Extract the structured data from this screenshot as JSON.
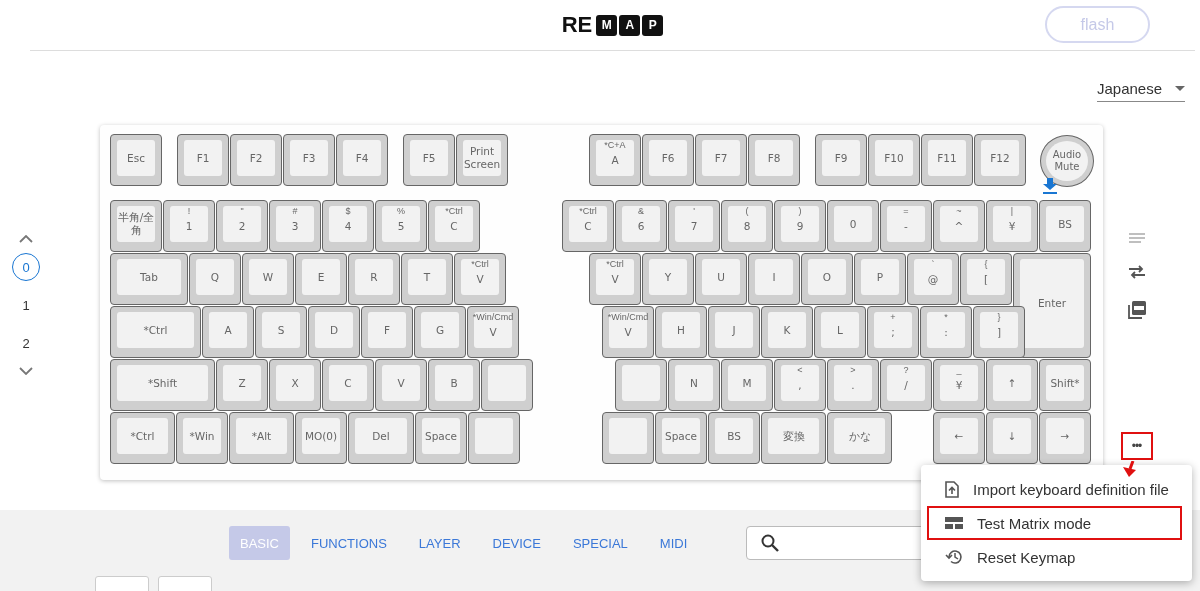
{
  "header": {
    "logo": [
      "RE",
      "M",
      "A",
      "P"
    ],
    "flash_button": {
      "label": "flash",
      "disabled": true
    }
  },
  "language_select": {
    "value": "Japanese"
  },
  "layers": [
    {
      "label": "0",
      "selected": true
    },
    {
      "label": "1",
      "selected": false
    },
    {
      "label": "2",
      "selected": false
    }
  ],
  "keyboard": {
    "left": [
      [
        {
          "kind": "square",
          "label": "Esc"
        },
        {
          "kind": "square",
          "label": "F1"
        },
        {
          "kind": "square",
          "label": "F2"
        },
        {
          "kind": "square",
          "label": "F3"
        },
        {
          "kind": "square",
          "label": "F4"
        },
        {
          "kind": "square",
          "label": "F5"
        },
        {
          "kind": "square",
          "label": "Print Screen"
        }
      ],
      [
        {
          "kind": "square",
          "label": "半角/全角"
        },
        {
          "kind": "square",
          "top": "!",
          "label": "1"
        },
        {
          "kind": "square",
          "top": "\"",
          "label": "2"
        },
        {
          "kind": "square",
          "top": "#",
          "label": "3"
        },
        {
          "kind": "square",
          "top": "$",
          "label": "4"
        },
        {
          "kind": "square",
          "top": "%",
          "label": "5"
        },
        {
          "kind": "square",
          "top": "*Ctrl",
          "label": "C"
        }
      ],
      [
        {
          "kind": "square",
          "label": "Tab"
        },
        {
          "kind": "square",
          "label": "Q"
        },
        {
          "kind": "square",
          "label": "W"
        },
        {
          "kind": "square",
          "label": "E"
        },
        {
          "kind": "square",
          "label": "R"
        },
        {
          "kind": "square",
          "label": "T"
        },
        {
          "kind": "square",
          "top": "*Ctrl",
          "label": "V"
        }
      ],
      [
        {
          "kind": "square",
          "label": "*Ctrl"
        },
        {
          "kind": "square",
          "label": "A"
        },
        {
          "kind": "square",
          "label": "S"
        },
        {
          "kind": "square",
          "label": "D"
        },
        {
          "kind": "square",
          "label": "F"
        },
        {
          "kind": "square",
          "label": "G"
        },
        {
          "kind": "square",
          "top": "*Win/Cmd",
          "label": "V"
        }
      ],
      [
        {
          "kind": "square",
          "label": "*Shift"
        },
        {
          "kind": "square",
          "label": "Z"
        },
        {
          "kind": "square",
          "label": "X"
        },
        {
          "kind": "square",
          "label": "C"
        },
        {
          "kind": "square",
          "label": "V"
        },
        {
          "kind": "square",
          "label": "B"
        },
        {
          "kind": "square"
        }
      ],
      [
        {
          "kind": "square",
          "label": "*Ctrl"
        },
        {
          "kind": "square",
          "label": "*Win"
        },
        {
          "kind": "square",
          "label": "*Alt"
        },
        {
          "kind": "square",
          "label": "MO(0)"
        },
        {
          "kind": "square",
          "label": "Del"
        },
        {
          "kind": "square",
          "label": "Space"
        },
        {
          "kind": "square"
        }
      ]
    ],
    "right": [
      [
        {
          "kind": "square",
          "top": "*C+A",
          "label": "A"
        },
        {
          "kind": "square",
          "label": "F6"
        },
        {
          "kind": "square",
          "label": "F7"
        },
        {
          "kind": "square",
          "label": "F8"
        },
        {
          "kind": "square",
          "label": "F9"
        },
        {
          "kind": "square",
          "label": "F10"
        },
        {
          "kind": "square",
          "label": "F11"
        },
        {
          "kind": "square",
          "label": "F12"
        },
        {
          "kind": "round",
          "label": "Audio Mute"
        }
      ],
      [
        {
          "kind": "square",
          "top": "*Ctrl",
          "label": "C"
        },
        {
          "kind": "square",
          "top": "&",
          "label": "6"
        },
        {
          "kind": "square",
          "top": "'",
          "label": "7"
        },
        {
          "kind": "square",
          "top": "(",
          "label": "8"
        },
        {
          "kind": "square",
          "top": ")",
          "label": "9"
        },
        {
          "kind": "square",
          "label": "0"
        },
        {
          "kind": "square",
          "top": "=",
          "label": "-"
        },
        {
          "kind": "square",
          "top": "~",
          "label": "^"
        },
        {
          "kind": "square",
          "top": "|",
          "label": "¥"
        },
        {
          "kind": "square",
          "label": "BS"
        }
      ],
      [
        {
          "kind": "square",
          "top": "*Ctrl",
          "label": "V"
        },
        {
          "kind": "square",
          "label": "Y"
        },
        {
          "kind": "square",
          "label": "U"
        },
        {
          "kind": "square",
          "label": "I"
        },
        {
          "kind": "square",
          "label": "O"
        },
        {
          "kind": "square",
          "label": "P"
        },
        {
          "kind": "square",
          "top": "`",
          "label": "@"
        },
        {
          "kind": "square",
          "top": "{",
          "label": "["
        },
        {
          "kind": "square",
          "label": "Enter"
        }
      ],
      [
        {
          "kind": "square",
          "top": "*Win/Cmd",
          "label": "V"
        },
        {
          "kind": "square",
          "label": "H"
        },
        {
          "kind": "square",
          "label": "J"
        },
        {
          "kind": "square",
          "label": "K"
        },
        {
          "kind": "square",
          "label": "L"
        },
        {
          "kind": "square",
          "top": "+",
          "label": ";"
        },
        {
          "kind": "square",
          "top": "*",
          "label": ":"
        },
        {
          "kind": "square",
          "top": "}",
          "label": "]"
        }
      ],
      [
        {
          "kind": "square"
        },
        {
          "kind": "square",
          "label": "N"
        },
        {
          "kind": "square",
          "label": "M"
        },
        {
          "kind": "square",
          "top": "<",
          "label": ","
        },
        {
          "kind": "square",
          "top": ">",
          "label": "."
        },
        {
          "kind": "square",
          "top": "?",
          "label": "/"
        },
        {
          "kind": "square",
          "top": "_",
          "label": "¥"
        },
        {
          "kind": "square",
          "label": "↑"
        },
        {
          "kind": "square",
          "label": "Shift*"
        }
      ],
      [
        {
          "kind": "square"
        },
        {
          "kind": "square",
          "label": "Space"
        },
        {
          "kind": "square",
          "label": "BS"
        },
        {
          "kind": "square",
          "label": "変換"
        },
        {
          "kind": "square",
          "label": "かな"
        },
        {
          "kind": "square",
          "label": "←"
        },
        {
          "kind": "square",
          "label": "↓"
        },
        {
          "kind": "square",
          "label": "→"
        }
      ]
    ]
  },
  "more_button": {
    "label": "•••",
    "highlighted": true
  },
  "menu": [
    {
      "label": "Import keyboard definition file",
      "highlighted": false
    },
    {
      "label": "Test Matrix mode",
      "highlighted": true
    },
    {
      "label": "Reset Keymap",
      "highlighted": false
    }
  ],
  "tabs": [
    {
      "label": "BASIC",
      "selected": true
    },
    {
      "label": "FUNCTIONS",
      "selected": false
    },
    {
      "label": "LAYER",
      "selected": false
    },
    {
      "label": "DEVICE",
      "selected": false
    },
    {
      "label": "SPECIAL",
      "selected": false
    },
    {
      "label": "MIDI",
      "selected": false
    }
  ]
}
